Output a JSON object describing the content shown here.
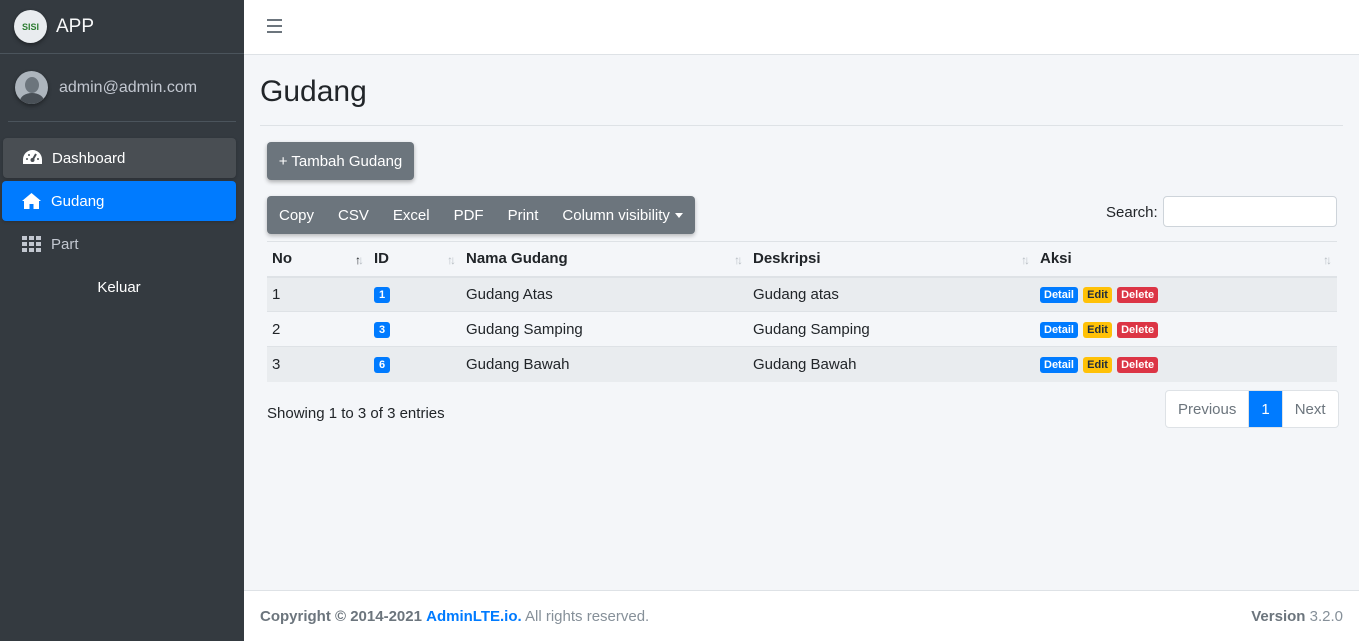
{
  "brand": {
    "logo_text": "SISI",
    "title": "APP"
  },
  "user": {
    "name": "admin@admin.com"
  },
  "sidebar": {
    "items": [
      {
        "label": "Dashboard",
        "icon": "tachometer-icon"
      },
      {
        "label": "Gudang",
        "icon": "home-icon",
        "active": true
      },
      {
        "label": "Part",
        "icon": "grid-icon"
      },
      {
        "label": "Keluar"
      }
    ]
  },
  "page": {
    "title": "Gudang"
  },
  "toolbar": {
    "add_label": "+ Tambah Gudang",
    "export_buttons": [
      "Copy",
      "CSV",
      "Excel",
      "PDF",
      "Print",
      "Column visibility"
    ],
    "search_label": "Search:",
    "search_value": ""
  },
  "table": {
    "headers": [
      "No",
      "ID",
      "Nama Gudang",
      "Deskripsi",
      "Aksi"
    ],
    "rows": [
      {
        "no": "1",
        "id": "1",
        "nama": "Gudang Atas",
        "deskripsi": "Gudang atas"
      },
      {
        "no": "2",
        "id": "3",
        "nama": "Gudang Samping",
        "deskripsi": "Gudang Samping"
      },
      {
        "no": "3",
        "id": "6",
        "nama": "Gudang Bawah",
        "deskripsi": "Gudang Bawah"
      }
    ],
    "actions": [
      "Detail",
      "Edit",
      "Delete"
    ]
  },
  "pagination": {
    "info": "Showing 1 to 3 of 3 entries",
    "previous": "Previous",
    "current": "1",
    "next": "Next"
  },
  "footer": {
    "copyright_prefix": "Copyright © 2014-2021",
    "link": "AdminLTE.io.",
    "suffix": "All rights reserved.",
    "version_label": "Version",
    "version": "3.2.0"
  },
  "colors": {
    "primary": "#007bff",
    "sidebar": "#343a40",
    "secondary": "#6c757d",
    "warning": "#ffc107",
    "danger": "#dc3545"
  }
}
